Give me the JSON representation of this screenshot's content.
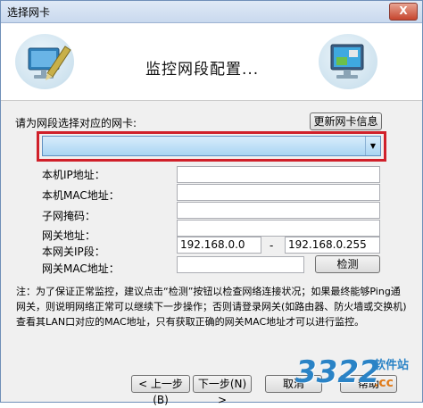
{
  "window": {
    "title": "选择网卡",
    "close_label": "X"
  },
  "banner": {
    "title": "监控网段配置..."
  },
  "nic": {
    "prompt": "请为网段选择对应的网卡:",
    "update_button": "更新网卡信息",
    "selected": "",
    "dropdown_arrow": "▼"
  },
  "fields": {
    "ip_label": "本机IP地址：",
    "mac_label": "本机MAC地址：",
    "mask_label": "子网掩码：",
    "gateway_label": "网关地址：",
    "gateway_ip_label": "本网关IP段：",
    "range_start": "192.168.0.0",
    "range_dash": "-",
    "range_end": "192.168.0.255",
    "gateway_mac_label": "网关MAC地址：",
    "detect_button": "检测"
  },
  "note": "注：为了保证正常监控，建议点击“检测”按钮以检查网络连接状况；如果最终能够Ping通网关，则说明网络正常可以继续下一步操作；否则请登录网关(如路由器、防火墙或交换机)查看其LAN口对应的MAC地址，只有获取正确的网关MAC地址才可以进行监控。",
  "footer": {
    "back": "< 上一步(B)",
    "next": "下一步(N) >",
    "cancel": "取消",
    "help": "帮助"
  },
  "watermark": {
    "number": "3322",
    "site": "软件站",
    "suffix": ".cc"
  }
}
